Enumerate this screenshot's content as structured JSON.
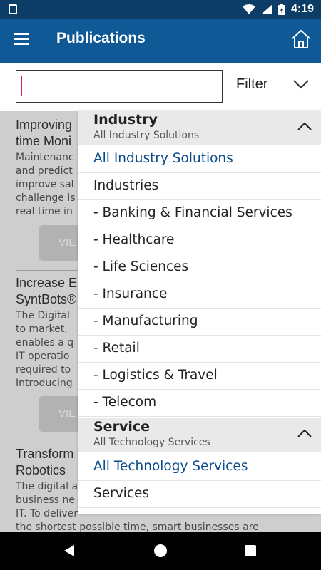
{
  "status_bar": {
    "time": "4:19"
  },
  "app_bar": {
    "title": "Publications"
  },
  "search": {
    "value": "",
    "placeholder": ""
  },
  "filter": {
    "label": "Filter"
  },
  "articles": [
    {
      "title_lines": [
        "Improving",
        "time Moni"
      ],
      "body_lines": [
        "Maintenanc",
        "and predict",
        "improve sat",
        "challenge is",
        "real time in"
      ],
      "button": "VIE"
    },
    {
      "title_lines": [
        "Increase E",
        "SyntBots®"
      ],
      "body_lines": [
        "The Digital",
        "to market, ",
        "enables a q",
        "IT operatio",
        "required to",
        "Introducing"
      ],
      "button": "VIE"
    },
    {
      "title_lines": [
        "Transform",
        "Robotics"
      ],
      "body_lines": [
        "The digital a",
        "business ne",
        "IT. To deliver",
        "the shortest possible time, smart businesses are"
      ]
    }
  ],
  "dropdown": {
    "groups": [
      {
        "title": "Industry",
        "subtitle": "All Industry Solutions",
        "icon": "chevron-up-icon",
        "options": [
          "All Industry Solutions",
          "Industries",
          "- Banking & Financial Services",
          "- Healthcare",
          "- Life Sciences",
          "- Insurance",
          "- Manufacturing",
          "- Retail",
          "- Logistics & Travel",
          "- Telecom"
        ],
        "selected": "All Industry Solutions"
      },
      {
        "title": "Service",
        "subtitle": "All Technology Services",
        "icon": "chevron-up-icon",
        "options": [
          "All Technology Services",
          "Services"
        ],
        "selected": "All Technology Services"
      }
    ]
  },
  "colors": {
    "status_bar": "#0b3d67",
    "app_bar": "#0f5a96",
    "selected_option": "#0b4c8a",
    "cursor": "#d81b60"
  }
}
